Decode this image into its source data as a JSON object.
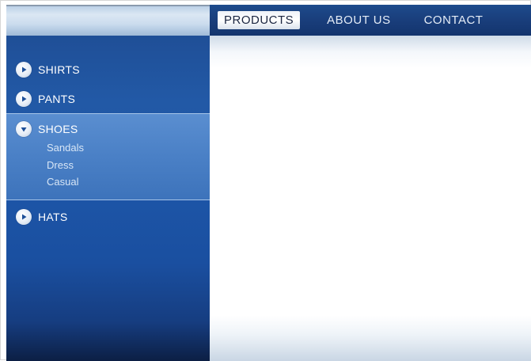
{
  "nav": {
    "items": [
      {
        "label": "PRODUCTS",
        "active": true
      },
      {
        "label": "ABOUT US",
        "active": false
      },
      {
        "label": "CONTACT",
        "active": false
      }
    ]
  },
  "sidebar": {
    "items": [
      {
        "label": "SHIRTS",
        "icon": "play-circle-icon",
        "expanded": false
      },
      {
        "label": "PANTS",
        "icon": "play-circle-icon",
        "expanded": false
      },
      {
        "label": "SHOES",
        "icon": "chevron-down-circle-icon",
        "expanded": true,
        "children": [
          {
            "label": "Sandals"
          },
          {
            "label": "Dress"
          },
          {
            "label": "Casual"
          }
        ]
      },
      {
        "label": "HATS",
        "icon": "play-circle-icon",
        "expanded": false
      }
    ]
  },
  "colors": {
    "nav_bar": "#1a3f7d",
    "sidebar": "#1d56a8",
    "sidebar_open": "#4a80c6",
    "icon_arrow": "#1d4f98"
  }
}
